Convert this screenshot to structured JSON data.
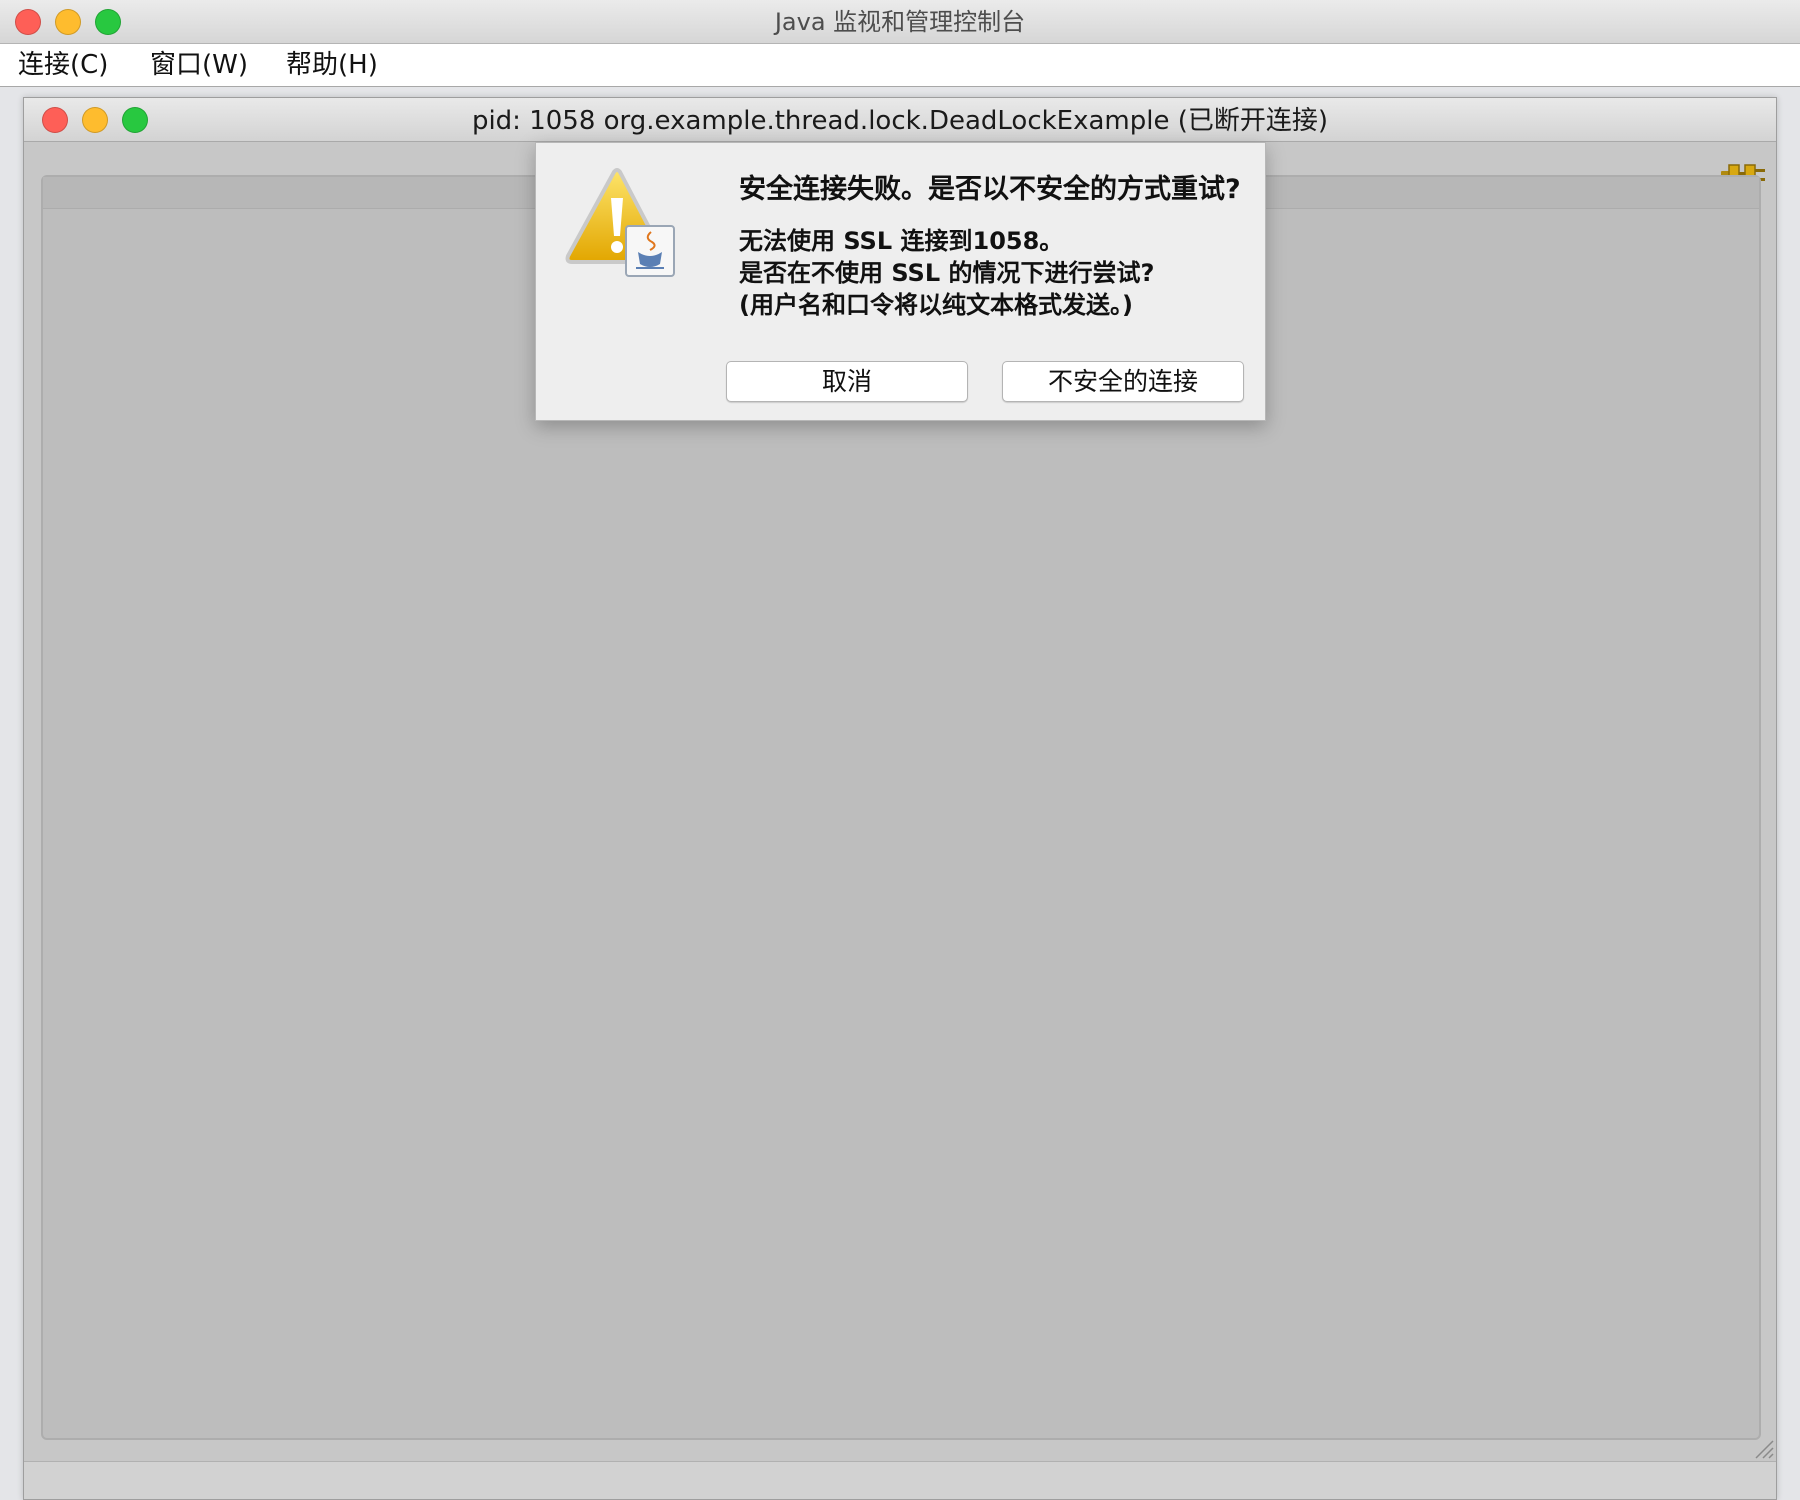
{
  "app": {
    "title": "Java 监视和管理控制台"
  },
  "menu": {
    "items": [
      {
        "label": "连接(C)"
      },
      {
        "label": "窗口(W)"
      },
      {
        "label": "帮助(H)"
      }
    ]
  },
  "inner_window": {
    "title": "pid: 1058 org.example.thread.lock.DeadLockExample (已断开连接)"
  },
  "dialog": {
    "headline": "安全连接失败。是否以不安全的方式重试?",
    "message_lines": [
      "无法使用 SSL 连接到1058。",
      "是否在不使用 SSL 的情况下进行尝试?",
      "(用户名和口令将以纯文本格式发送。)"
    ],
    "buttons": {
      "cancel": "取消",
      "insecure": "不安全的连接"
    }
  },
  "icons": {
    "warning": "warning-icon",
    "java": "java-cup-icon",
    "connection": "plug-icon"
  },
  "colors": {
    "close": "#fe5f57",
    "minimize": "#febc2e",
    "zoom": "#28c840",
    "warning": "#f2c200"
  }
}
